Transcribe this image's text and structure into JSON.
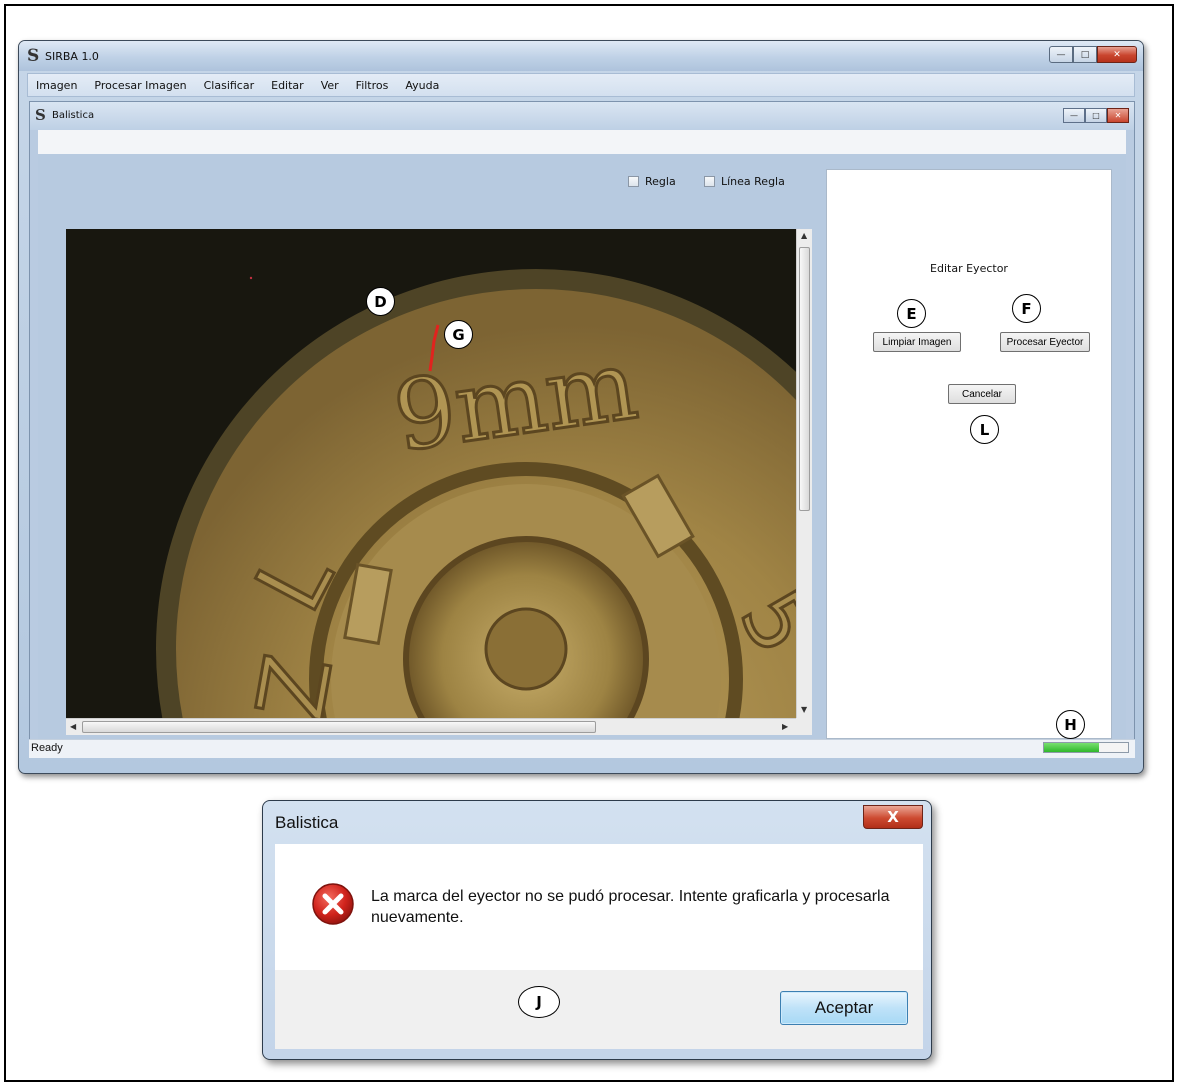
{
  "main_window": {
    "title": "SIRBA 1.0",
    "logo_glyph": "S",
    "menu": [
      "Imagen",
      "Procesar Imagen",
      "Clasificar",
      "Editar",
      "Ver",
      "Filtros",
      "Ayuda"
    ],
    "status": "Ready",
    "progress_percent": 65
  },
  "child_window": {
    "title": "Balistica",
    "checkboxes": [
      {
        "label": "Regla",
        "checked": false
      },
      {
        "label": "Línea Regla",
        "checked": false
      }
    ]
  },
  "image": {
    "engraving": "9mm",
    "icon": "cartridge-headstamp-image"
  },
  "side_panel": {
    "title": "Editar Eyector",
    "btn_clear": "Limpiar Imagen",
    "btn_process": "Procesar Eyector",
    "btn_cancel": "Cancelar"
  },
  "callouts": {
    "D": "D",
    "E": "E",
    "F": "F",
    "G": "G",
    "H": "H",
    "J": "J",
    "L": "L"
  },
  "dialog": {
    "title": "Balistica",
    "close_glyph": "X",
    "message": "La marca del eyector no se pudó procesar. Intente graficarla y procesarla nuevamente.",
    "ok_label": "Aceptar",
    "icon": "error-icon"
  },
  "colors": {
    "brass": "#a88c4c",
    "error_red": "#c8262a",
    "progress_green": "#2fb82b"
  }
}
